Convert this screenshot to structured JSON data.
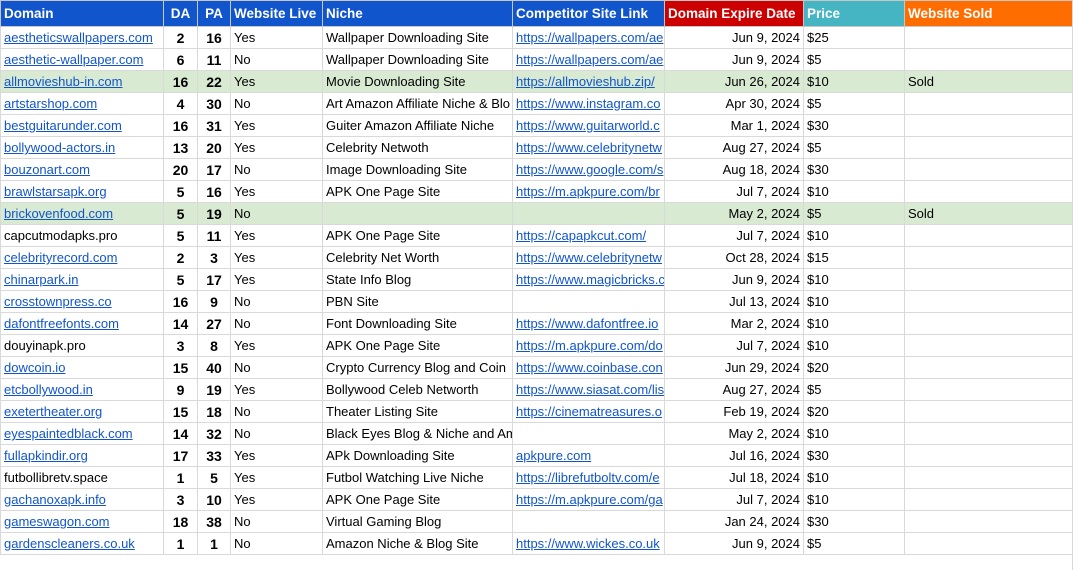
{
  "colors": {
    "header_blue": "#1155cc",
    "header_red": "#cc0000",
    "header_teal": "#45b5c4",
    "header_orange": "#ff6d01",
    "sold_row": "#d9ead3",
    "link": "#1155cc"
  },
  "headers": [
    "Domain",
    "DA",
    "PA",
    "Website Live",
    "Niche",
    "Competitor Site Link",
    "Domain Expire Date",
    "Price",
    "Website Sold"
  ],
  "rows": [
    {
      "domain": "aestheticswallpapers.com",
      "linked": true,
      "da": "2",
      "pa": "16",
      "live": "Yes",
      "niche": "Wallpaper Downloading Site",
      "competitor": "https://wallpapers.com/ae",
      "expire": "Jun 9, 2024",
      "price": "$25",
      "sold": ""
    },
    {
      "domain": "aesthetic-wallpaper.com",
      "linked": true,
      "da": "6",
      "pa": "11",
      "live": "No",
      "niche": "Wallpaper Downloading Site",
      "competitor": "https://wallpapers.com/ae",
      "expire": "Jun 9, 2024",
      "price": "$5",
      "sold": ""
    },
    {
      "domain": "allmovieshub-in.com",
      "linked": true,
      "da": "16",
      "pa": "22",
      "live": "Yes",
      "niche": "Movie Downloading Site",
      "competitor": "https://allmovieshub.zip/",
      "expire": "Jun 26, 2024",
      "price": "$10",
      "sold": "Sold"
    },
    {
      "domain": "artstarshop.com",
      "linked": true,
      "da": "4",
      "pa": "30",
      "live": "No",
      "niche": "Art Amazon Affiliate Niche & Blo",
      "competitor": "https://www.instagram.co",
      "expire": "Apr 30, 2024",
      "price": "$5",
      "sold": ""
    },
    {
      "domain": "bestguitarunder.com",
      "linked": true,
      "da": "16",
      "pa": "31",
      "live": "Yes",
      "niche": "Guiter Amazon Affiliate Niche",
      "competitor": "https://www.guitarworld.c",
      "expire": "Mar 1, 2024",
      "price": "$30",
      "sold": ""
    },
    {
      "domain": "bollywood-actors.in",
      "linked": true,
      "da": "13",
      "pa": "20",
      "live": "Yes",
      "niche": "Celebrity Netwoth",
      "competitor": "https://www.celebritynetw",
      "expire": "Aug 27, 2024",
      "price": "$5",
      "sold": ""
    },
    {
      "domain": "bouzonart.com",
      "linked": true,
      "da": "20",
      "pa": "17",
      "live": "No",
      "niche": "Image Downloading Site",
      "competitor": "https://www.google.com/s",
      "expire": "Aug 18, 2024",
      "price": "$30",
      "sold": ""
    },
    {
      "domain": "brawlstarsapk.org",
      "linked": true,
      "da": "5",
      "pa": "16",
      "live": "Yes",
      "niche": "APK One Page Site",
      "competitor": "https://m.apkpure.com/br",
      "expire": "Jul 7, 2024",
      "price": "$10",
      "sold": ""
    },
    {
      "domain": "brickovenfood.com",
      "linked": true,
      "da": "5",
      "pa": "19",
      "live": "No",
      "niche": "",
      "competitor": "",
      "expire": "May 2, 2024",
      "price": "$5",
      "sold": "Sold"
    },
    {
      "domain": "capcutmodapks.pro",
      "linked": false,
      "da": "5",
      "pa": "11",
      "live": "Yes",
      "niche": "APK One Page Site",
      "competitor": "https://capapkcut.com/",
      "expire": "Jul 7, 2024",
      "price": "$10",
      "sold": ""
    },
    {
      "domain": "celebrityrecord.com",
      "linked": true,
      "da": "2",
      "pa": "3",
      "live": "Yes",
      "niche": "Celebrity Net Worth",
      "competitor": "https://www.celebritynetw",
      "expire": "Oct 28, 2024",
      "price": "$15",
      "sold": ""
    },
    {
      "domain": "chinarpark.in",
      "linked": true,
      "da": "5",
      "pa": "17",
      "live": "Yes",
      "niche": "State Info Blog",
      "competitor": "https://www.magicbricks.c",
      "expire": "Jun 9, 2024",
      "price": "$10",
      "sold": ""
    },
    {
      "domain": "crosstownpress.co",
      "linked": true,
      "da": "16",
      "pa": "9",
      "live": "No",
      "niche": "PBN Site",
      "competitor": "",
      "expire": "Jul 13, 2024",
      "price": "$10",
      "sold": ""
    },
    {
      "domain": "dafontfreefonts.com",
      "linked": true,
      "da": "14",
      "pa": "27",
      "live": "No",
      "niche": "Font Downloading Site",
      "competitor": "https://www.dafontfree.io",
      "expire": "Mar 2, 2024",
      "price": "$10",
      "sold": ""
    },
    {
      "domain": "douyinapk.pro",
      "linked": false,
      "da": "3",
      "pa": "8",
      "live": "Yes",
      "niche": "APK One Page Site",
      "competitor": "https://m.apkpure.com/do",
      "expire": "Jul 7, 2024",
      "price": "$10",
      "sold": ""
    },
    {
      "domain": "dowcoin.io",
      "linked": true,
      "da": "15",
      "pa": "40",
      "live": "No",
      "niche": "Crypto Currency Blog and Coin",
      "competitor": "https://www.coinbase.con",
      "expire": "Jun 29, 2024",
      "price": "$20",
      "sold": ""
    },
    {
      "domain": "etcbollywood.in",
      "linked": true,
      "da": "9",
      "pa": "19",
      "live": "Yes",
      "niche": "Bollywood Celeb Networth",
      "competitor": "https://www.siasat.com/lis",
      "expire": "Aug 27, 2024",
      "price": "$5",
      "sold": ""
    },
    {
      "domain": "exetertheater.org",
      "linked": true,
      "da": "15",
      "pa": "18",
      "live": "No",
      "niche": "Theater Listing Site",
      "competitor": "https://cinematreasures.o",
      "expire": "Feb 19, 2024",
      "price": "$20",
      "sold": ""
    },
    {
      "domain": "eyespaintedblack.com",
      "linked": true,
      "da": "14",
      "pa": "32",
      "live": "No",
      "niche": "Black Eyes Blog & Niche and Amazon Affiliate",
      "competitor": "",
      "expire": "May 2, 2024",
      "price": "$10",
      "sold": ""
    },
    {
      "domain": "fullapkindir.org",
      "linked": true,
      "da": "17",
      "pa": "33",
      "live": "Yes",
      "niche": "APk Downloading Site",
      "competitor": "apkpure.com",
      "expire": "Jul 16, 2024",
      "price": "$30",
      "sold": ""
    },
    {
      "domain": "futbollibretv.space",
      "linked": false,
      "da": "1",
      "pa": "5",
      "live": "Yes",
      "niche": "Futbol Watching Live Niche",
      "competitor": "https://librefutboltv.com/e",
      "expire": "Jul 18, 2024",
      "price": "$10",
      "sold": ""
    },
    {
      "domain": "gachanoxapk.info",
      "linked": true,
      "da": "3",
      "pa": "10",
      "live": "Yes",
      "niche": "APK One Page Site",
      "competitor": "https://m.apkpure.com/ga",
      "expire": "Jul 7, 2024",
      "price": "$10",
      "sold": ""
    },
    {
      "domain": "gameswagon.com",
      "linked": true,
      "da": "18",
      "pa": "38",
      "live": "No",
      "niche": "Virtual Gaming Blog",
      "competitor": "",
      "expire": "Jan 24, 2024",
      "price": "$30",
      "sold": ""
    },
    {
      "domain": "gardenscleaners.co.uk",
      "linked": true,
      "da": "1",
      "pa": "1",
      "live": "No",
      "niche": "Amazon Niche & Blog Site",
      "competitor": "https://www.wickes.co.uk",
      "expire": "Jun 9, 2024",
      "price": "$5",
      "sold": ""
    }
  ]
}
